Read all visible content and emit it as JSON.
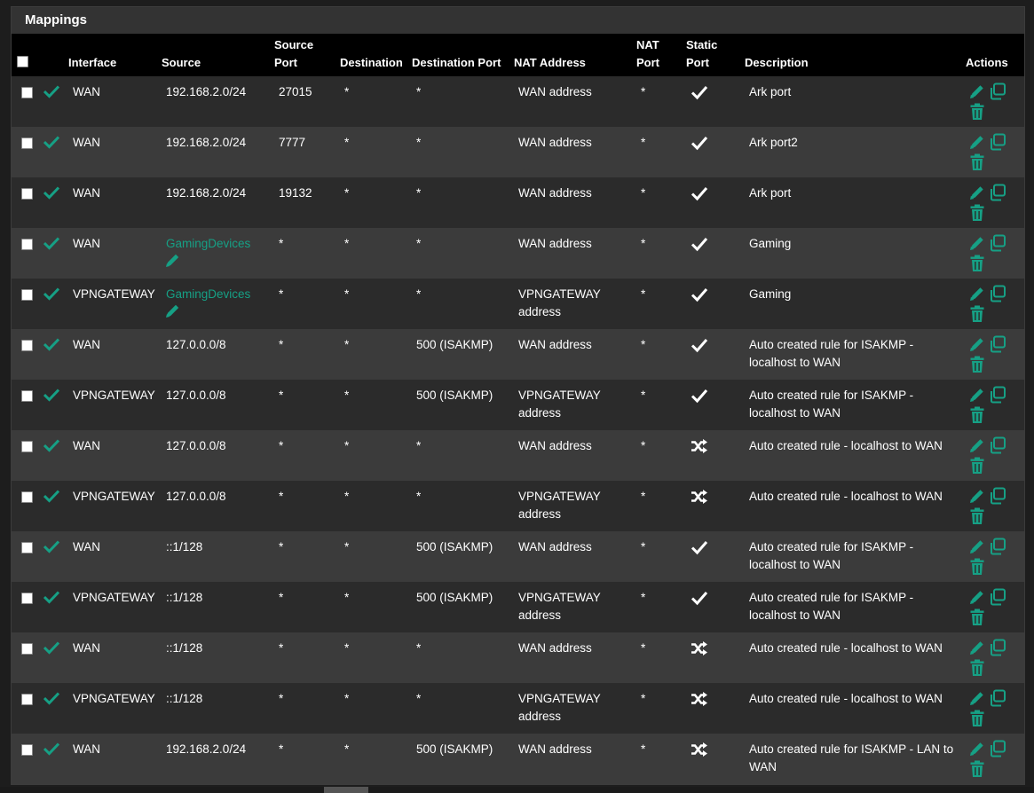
{
  "panel": {
    "title": "Mappings"
  },
  "colors": {
    "accent": "#16a085",
    "header_bg": "#000000",
    "row_odd": "#2b2b2b",
    "row_even": "#3b3b3b"
  },
  "headers": {
    "interface": "Interface",
    "source": "Source",
    "source_port_1": "Source",
    "source_port_2": "Port",
    "destination": "Destination",
    "destination_port": "Destination Port",
    "nat_address": "NAT Address",
    "nat_port_1": "NAT",
    "nat_port_2": "Port",
    "static_port_1": "Static",
    "static_port_2": "Port",
    "description": "Description",
    "actions": "Actions"
  },
  "rows": [
    {
      "interface": "WAN",
      "source": "192.168.2.0/24",
      "source_link": false,
      "source_port": "27015",
      "destination": "*",
      "destination_port": "*",
      "nat1": "WAN address",
      "nat2": "",
      "nat_port": "*",
      "static": "check",
      "desc1": "Ark port",
      "desc2": ""
    },
    {
      "interface": "WAN",
      "source": "192.168.2.0/24",
      "source_link": false,
      "source_port": "7777",
      "destination": "*",
      "destination_port": "*",
      "nat1": "WAN address",
      "nat2": "",
      "nat_port": "*",
      "static": "check",
      "desc1": "Ark port2",
      "desc2": ""
    },
    {
      "interface": "WAN",
      "source": "192.168.2.0/24",
      "source_link": false,
      "source_port": "19132",
      "destination": "*",
      "destination_port": "*",
      "nat1": "WAN address",
      "nat2": "",
      "nat_port": "*",
      "static": "check",
      "desc1": "Ark port",
      "desc2": ""
    },
    {
      "interface": "WAN",
      "source": "GamingDevices",
      "source_link": true,
      "source_port": "*",
      "destination": "*",
      "destination_port": "*",
      "nat1": "WAN address",
      "nat2": "",
      "nat_port": "*",
      "static": "check",
      "desc1": "Gaming",
      "desc2": ""
    },
    {
      "interface": "VPNGATEWAY",
      "source": "GamingDevices",
      "source_link": true,
      "source_port": "*",
      "destination": "*",
      "destination_port": "*",
      "nat1": "VPNGATEWAY",
      "nat2": "address",
      "nat_port": "*",
      "static": "check",
      "desc1": "Gaming",
      "desc2": ""
    },
    {
      "interface": "WAN",
      "source": "127.0.0.0/8",
      "source_link": false,
      "source_port": "*",
      "destination": "*",
      "destination_port": "500 (ISAKMP)",
      "nat1": "WAN address",
      "nat2": "",
      "nat_port": "*",
      "static": "check",
      "desc1": "Auto created rule for ISAKMP -",
      "desc2": "localhost to WAN"
    },
    {
      "interface": "VPNGATEWAY",
      "source": "127.0.0.0/8",
      "source_link": false,
      "source_port": "*",
      "destination": "*",
      "destination_port": "500 (ISAKMP)",
      "nat1": "VPNGATEWAY",
      "nat2": "address",
      "nat_port": "*",
      "static": "check",
      "desc1": "Auto created rule for ISAKMP -",
      "desc2": "localhost to WAN"
    },
    {
      "interface": "WAN",
      "source": "127.0.0.0/8",
      "source_link": false,
      "source_port": "*",
      "destination": "*",
      "destination_port": "*",
      "nat1": "WAN address",
      "nat2": "",
      "nat_port": "*",
      "static": "random",
      "desc1": "Auto created rule - localhost to WAN",
      "desc2": ""
    },
    {
      "interface": "VPNGATEWAY",
      "source": "127.0.0.0/8",
      "source_link": false,
      "source_port": "*",
      "destination": "*",
      "destination_port": "*",
      "nat1": "VPNGATEWAY",
      "nat2": "address",
      "nat_port": "*",
      "static": "random",
      "desc1": "Auto created rule - localhost to WAN",
      "desc2": ""
    },
    {
      "interface": "WAN",
      "source": "::1/128",
      "source_link": false,
      "source_port": "*",
      "destination": "*",
      "destination_port": "500 (ISAKMP)",
      "nat1": "WAN address",
      "nat2": "",
      "nat_port": "*",
      "static": "check",
      "desc1": "Auto created rule for ISAKMP -",
      "desc2": "localhost to WAN"
    },
    {
      "interface": "VPNGATEWAY",
      "source": "::1/128",
      "source_link": false,
      "source_port": "*",
      "destination": "*",
      "destination_port": "500 (ISAKMP)",
      "nat1": "VPNGATEWAY",
      "nat2": "address",
      "nat_port": "*",
      "static": "check",
      "desc1": "Auto created rule for ISAKMP -",
      "desc2": "localhost to WAN"
    },
    {
      "interface": "WAN",
      "source": "::1/128",
      "source_link": false,
      "source_port": "*",
      "destination": "*",
      "destination_port": "*",
      "nat1": "WAN address",
      "nat2": "",
      "nat_port": "*",
      "static": "random",
      "desc1": "Auto created rule - localhost to WAN",
      "desc2": ""
    },
    {
      "interface": "VPNGATEWAY",
      "source": "::1/128",
      "source_link": false,
      "source_port": "*",
      "destination": "*",
      "destination_port": "*",
      "nat1": "VPNGATEWAY",
      "nat2": "address",
      "nat_port": "*",
      "static": "random",
      "desc1": "Auto created rule - localhost to WAN",
      "desc2": ""
    },
    {
      "interface": "WAN",
      "source": "192.168.2.0/24",
      "source_link": false,
      "source_port": "*",
      "destination": "*",
      "destination_port": "500 (ISAKMP)",
      "nat1": "WAN address",
      "nat2": "",
      "nat_port": "*",
      "static": "random",
      "desc1": "Auto created rule for ISAKMP - LAN to",
      "desc2": "WAN"
    }
  ]
}
